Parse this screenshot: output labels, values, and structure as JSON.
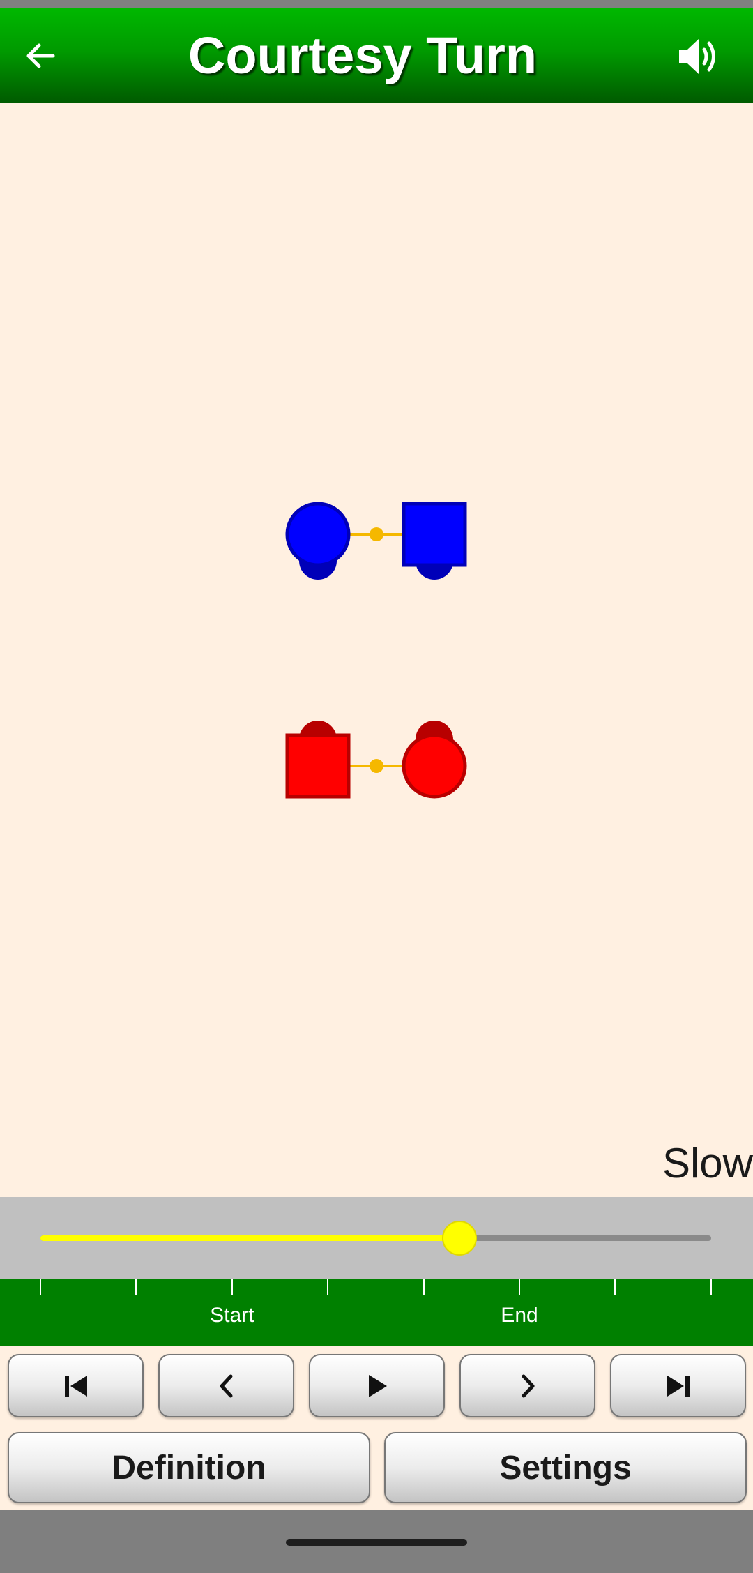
{
  "app_bar": {
    "title": "Courtesy Turn",
    "back_icon": "arrow-left-icon",
    "sound_icon": "speaker-volume-icon"
  },
  "animation": {
    "speed_label": "Slow",
    "dancers": [
      {
        "id": "couple-1-left",
        "shape": "circle",
        "color": "#0000ff",
        "facing": "down"
      },
      {
        "id": "couple-1-right",
        "shape": "square",
        "color": "#0000ff",
        "facing": "down"
      },
      {
        "id": "couple-2-left",
        "shape": "square",
        "color": "#ff0000",
        "facing": "up"
      },
      {
        "id": "couple-2-right",
        "shape": "circle",
        "color": "#ff0000",
        "facing": "up"
      }
    ],
    "handhold_color": "#f5b800"
  },
  "slider": {
    "progress": 0.625,
    "fill_color": "#ffff00",
    "tick_count": 8,
    "labels": {
      "start": "Start",
      "end": "End"
    }
  },
  "controls": {
    "nav_buttons": [
      {
        "name": "skip-to-start-button",
        "icon": "skip-back-icon"
      },
      {
        "name": "step-back-button",
        "icon": "chevron-left-icon"
      },
      {
        "name": "play-button",
        "icon": "play-icon"
      },
      {
        "name": "step-forward-button",
        "icon": "chevron-right-icon"
      },
      {
        "name": "skip-to-end-button",
        "icon": "skip-forward-icon"
      }
    ],
    "definition_label": "Definition",
    "settings_label": "Settings"
  },
  "colors": {
    "app_bar_green": "#00a000",
    "stage_background": "#fff0e1",
    "tick_bar_green": "#008000"
  }
}
